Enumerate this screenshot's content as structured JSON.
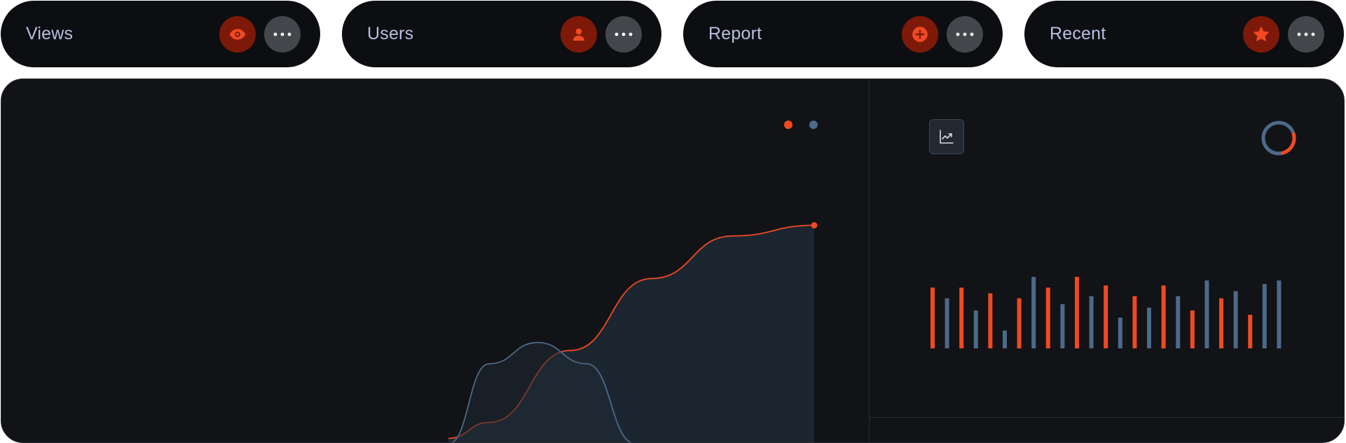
{
  "colors": {
    "accent": "#f04a23",
    "accent_dark": "#7d1909",
    "secondary": "#4c6a8a",
    "label": "#b8bfe3",
    "pill_bg": "#0d0e11",
    "panel_bg": "#121316"
  },
  "cards": [
    {
      "label": "Views",
      "icon": "eye-icon"
    },
    {
      "label": "Users",
      "icon": "user-icon"
    },
    {
      "label": "Report",
      "icon": "plus-circle-icon"
    },
    {
      "label": "Recent",
      "icon": "star-icon"
    }
  ],
  "chart_data": [
    {
      "type": "area",
      "series": [
        {
          "color": "#f04a23",
          "points": [
            [
              0.55,
              0.02
            ],
            [
              0.6,
              0.08
            ],
            [
              0.7,
              0.35
            ],
            [
              0.8,
              0.62
            ],
            [
              0.9,
              0.78
            ],
            [
              1.0,
              0.82
            ]
          ]
        },
        {
          "color": "#4c6a8a",
          "points": [
            [
              0.55,
              0.0
            ],
            [
              0.6,
              0.3
            ],
            [
              0.66,
              0.38
            ],
            [
              0.72,
              0.3
            ],
            [
              0.78,
              0.0
            ]
          ]
        }
      ],
      "legend": [
        "#f04a23",
        "#4c6a8a"
      ]
    },
    {
      "type": "bar",
      "values": [
        0.85,
        0.7,
        0.85,
        0.53,
        0.77,
        0.25,
        0.7,
        1.0,
        0.85,
        0.62,
        1.0,
        0.73,
        0.88,
        0.43,
        0.73,
        0.57,
        0.88,
        0.73,
        0.53,
        0.95,
        0.7,
        0.8,
        0.47,
        0.9,
        0.95
      ],
      "bar_colors": [
        "#f04a23",
        "#4c6a8a",
        "#f04a23",
        "#4c6a8a",
        "#f04a23",
        "#4c6a8a",
        "#f04a23",
        "#4c6a8a",
        "#f04a23",
        "#4c6a8a",
        "#f04a23",
        "#4c6a8a",
        "#f04a23",
        "#4c6a8a",
        "#f04a23",
        "#4c6a8a",
        "#f04a23",
        "#4c6a8a",
        "#f04a23",
        "#4c6a8a",
        "#f04a23",
        "#4c6a8a",
        "#f04a23",
        "#4c6a8a",
        "#4c6a8a"
      ]
    }
  ],
  "donut": {
    "fraction_accent": 0.28
  }
}
